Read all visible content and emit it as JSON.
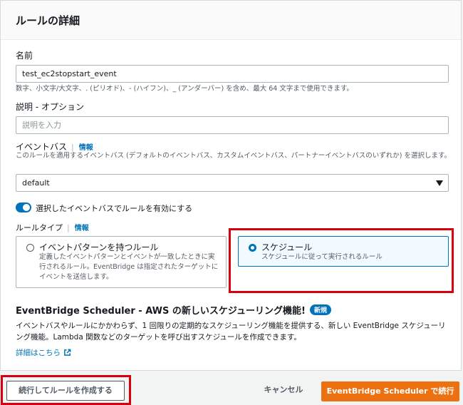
{
  "panel": {
    "title": "ルールの詳細"
  },
  "name_field": {
    "label": "名前",
    "value": "test_ec2stopstart_event",
    "hint": "数字、小文字/大文字、. (ピリオド)、- (ハイフン)、_ (アンダーバー) を含め、最大 64 文字まで使用できます。"
  },
  "description_field": {
    "label": "説明 - オプション",
    "placeholder": "説明を入力"
  },
  "event_bus": {
    "label": "イベントバス",
    "info": "情報",
    "hint": "このルールを適用するイベントバス (デフォルトのイベントバス、カスタムイベントバス、パートナーイベントバスのいずれか) を選択します。",
    "selected": "default",
    "toggle_label": "選択したイベントバスでルールを有効にする",
    "toggle_on": true
  },
  "rule_type": {
    "label": "ルールタイプ",
    "info": "情報",
    "options": [
      {
        "title": "イベントパターンを持つルール",
        "description": "定義したイベントパターンとイベントが一致したときに実行されるルール。EventBridge は指定されたターゲットにイベントを送信します。",
        "selected": false
      },
      {
        "title": "スケジュール",
        "description": "スケジュールに従って実行されるルール",
        "selected": true
      }
    ]
  },
  "scheduler_promo": {
    "title": "EventBridge Scheduler - AWS の新しいスケジューリング機能!",
    "badge": "新規",
    "body": "イベントバスやルールにかかわらず、1 回限りの定期的なスケジューリング機能を提供する、新しい EventBridge スケジューリング機能。Lambda 関数などのターゲットを呼び出すスケジュールを作成できます。",
    "link": "詳細はこちら"
  },
  "footer": {
    "continue_rule": "続行してルールを作成する",
    "cancel": "キャンセル",
    "continue_scheduler": "EventBridge Scheduler で続行"
  },
  "colors": {
    "accent": "#0073bb",
    "primary_button": "#ec7211",
    "highlight": "#d9000d"
  }
}
